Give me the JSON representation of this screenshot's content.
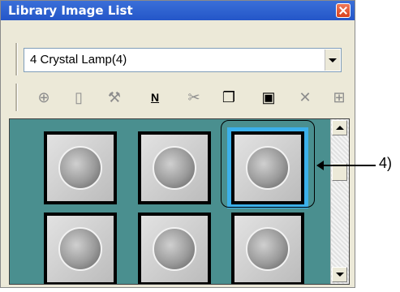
{
  "window": {
    "title": "Library Image List"
  },
  "combo": {
    "value": "4 Crystal Lamp(4)"
  },
  "toolbar": {
    "icons": [
      "new-folder-icon",
      "new-file-icon",
      "tools-icon",
      "n-badge-icon",
      "cut-icon",
      "copy-icon",
      "paste-icon",
      "delete-icon",
      "properties-icon"
    ],
    "active_icons": [
      "n-badge-icon",
      "copy-icon",
      "paste-icon"
    ]
  },
  "panel": {
    "rows": 2,
    "columns": 3,
    "selected_index": 2
  },
  "callout": {
    "label": "4)"
  },
  "colors": {
    "title_bar": "#2456c8",
    "panel_background": "#4a8f8f",
    "selection": "#3bb0ea"
  }
}
